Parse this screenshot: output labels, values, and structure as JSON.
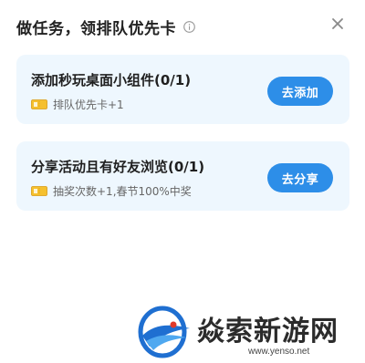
{
  "dialog": {
    "title": "做任务，领排队优先卡"
  },
  "tasks": [
    {
      "title": "添加秒玩桌面小组件(0/1)",
      "reward": "排队优先卡+1",
      "button": "去添加"
    },
    {
      "title": "分享活动且有好友浏览(0/1)",
      "reward": "抽奖次数+1,春节100%中奖",
      "button": "去分享"
    }
  ],
  "watermark": {
    "brand": "焱索新游网",
    "url": "www.yenso.net"
  },
  "colors": {
    "card_bg": "#eef7fe",
    "button_bg": "#2d8ee8",
    "ticket": "#f5c02e"
  },
  "icons": {
    "info": "info-icon",
    "close": "close-icon",
    "ticket": "ticket-icon"
  }
}
